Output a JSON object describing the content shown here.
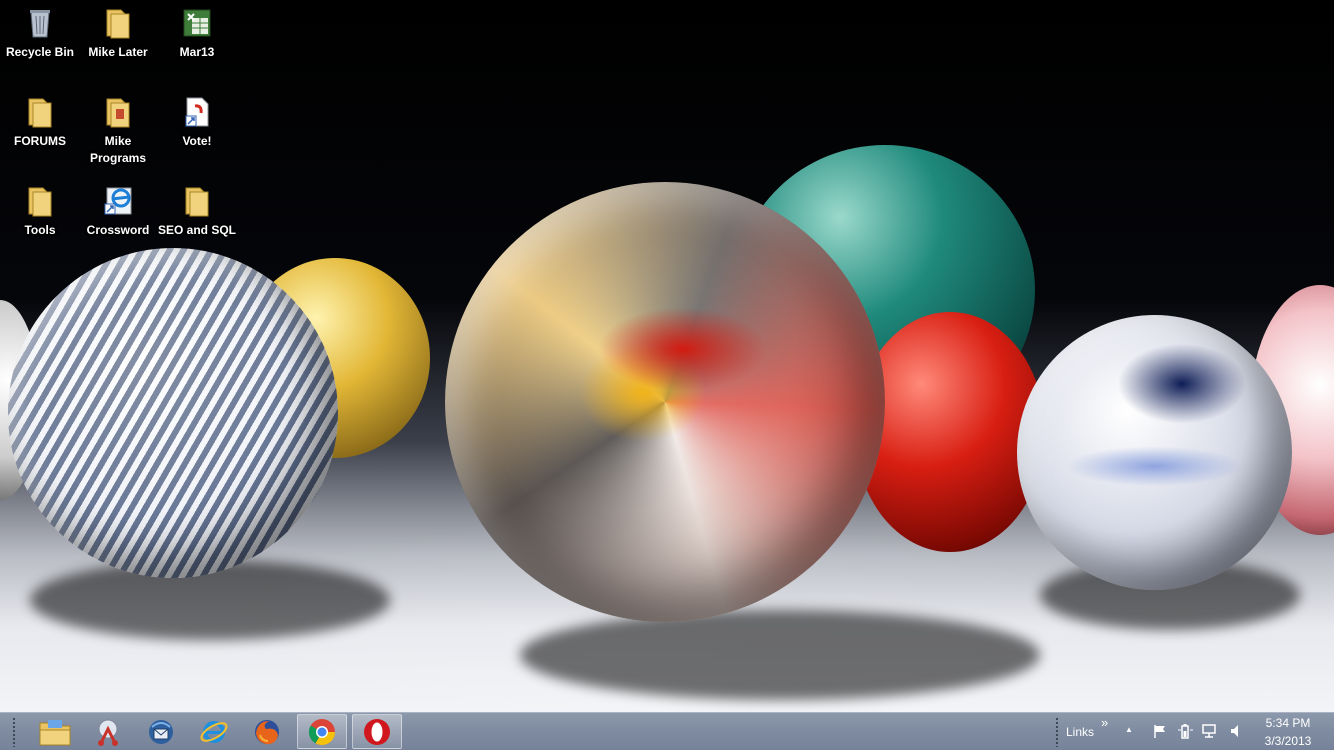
{
  "desktop": {
    "icons": [
      {
        "label": "Recycle Bin",
        "icon": "recycle-bin-icon"
      },
      {
        "label": "Mike Later",
        "icon": "folder-icon"
      },
      {
        "label": "Mar13",
        "icon": "spreadsheet-icon"
      },
      {
        "label": "FORUMS",
        "icon": "folder-icon"
      },
      {
        "label": "Mike Programs",
        "icon": "folder-icon"
      },
      {
        "label": "Vote!",
        "icon": "shortcut-document-icon"
      },
      {
        "label": "Tools",
        "icon": "folder-icon"
      },
      {
        "label": "Crossword",
        "icon": "shortcut-internet-explorer-icon"
      },
      {
        "label": "SEO and SQL",
        "icon": "folder-icon"
      }
    ],
    "wallpaper": "glass-marbles"
  },
  "taskbar": {
    "pinned": [
      {
        "name": "file-explorer",
        "icon": "file-explorer-icon"
      },
      {
        "name": "snipping-tool",
        "icon": "snipping-tool-icon"
      },
      {
        "name": "thunderbird",
        "icon": "thunderbird-icon"
      },
      {
        "name": "internet-explorer",
        "icon": "internet-explorer-icon"
      },
      {
        "name": "firefox",
        "icon": "firefox-icon"
      },
      {
        "name": "chrome",
        "icon": "chrome-icon"
      },
      {
        "name": "opera",
        "icon": "opera-icon"
      }
    ],
    "links_label": "Links",
    "links_chevron": "»",
    "tray_expand": "▲",
    "clock": {
      "time": "5:34 PM",
      "date": "3/3/2013"
    }
  },
  "colors": {
    "taskbar": "#7f8ba0",
    "folder": "#e8c463"
  }
}
